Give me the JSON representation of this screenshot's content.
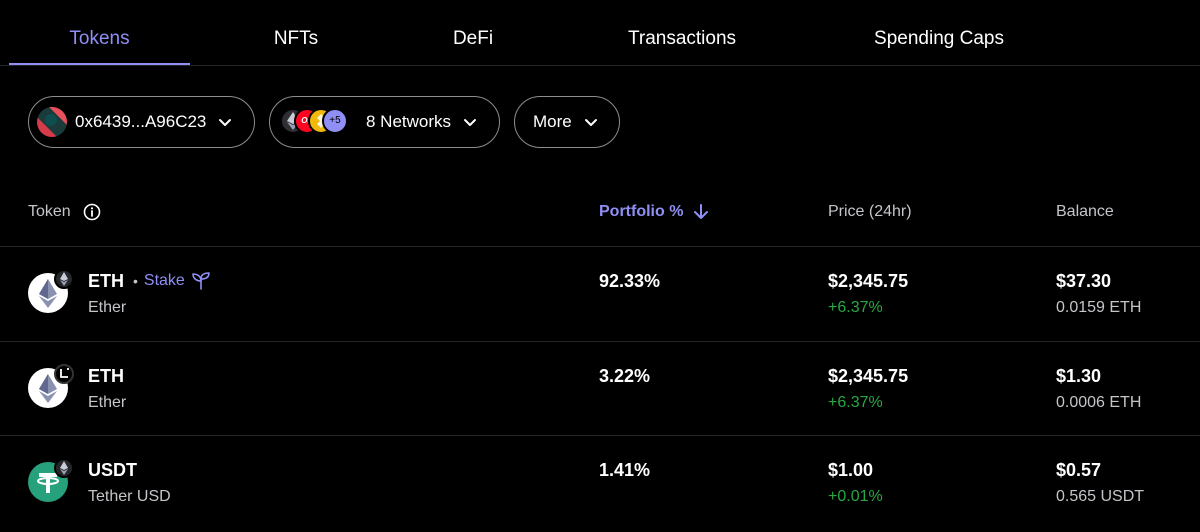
{
  "tabs": [
    {
      "label": "Tokens",
      "active": true
    },
    {
      "label": "NFTs",
      "active": false
    },
    {
      "label": "DeFi",
      "active": false
    },
    {
      "label": "Transactions",
      "active": false
    },
    {
      "label": "Spending Caps",
      "active": false
    }
  ],
  "filters": {
    "account": "0x6439...A96C23",
    "networks_label": "8 Networks",
    "networks_extra": "+5",
    "network_op_label": "OP",
    "more_label": "More"
  },
  "table": {
    "headers": {
      "token": "Token",
      "portfolio": "Portfolio %",
      "price": "Price (24hr)",
      "balance": "Balance"
    },
    "rows": [
      {
        "symbol": "ETH",
        "name": "Ether",
        "stake_label": "Stake",
        "portfolio": "92.33%",
        "price": "$2,345.75",
        "change": "+6.37%",
        "balance_usd": "$37.30",
        "balance_amount": "0.0159 ETH"
      },
      {
        "symbol": "ETH",
        "name": "Ether",
        "portfolio": "3.22%",
        "price": "$2,345.75",
        "change": "+6.37%",
        "balance_usd": "$1.30",
        "balance_amount": "0.0006 ETH"
      },
      {
        "symbol": "USDT",
        "name": "Tether USD",
        "portfolio": "1.41%",
        "price": "$1.00",
        "change": "+0.01%",
        "balance_usd": "$0.57",
        "balance_amount": "0.565 USDT"
      }
    ]
  },
  "colors": {
    "accent": "#8f8ff5",
    "positive": "#28a745",
    "background": "#000000",
    "divider": "#222428",
    "tether": "#26a17b"
  }
}
